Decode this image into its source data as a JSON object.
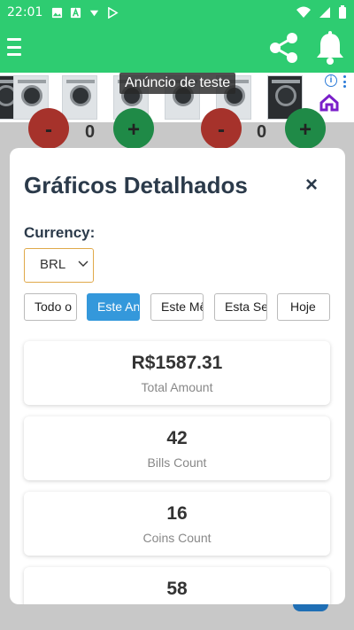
{
  "status_bar": {
    "time": "22:01",
    "icons": [
      "image-icon",
      "font-icon",
      "download-icon",
      "play-store-icon",
      "wifi-icon",
      "cell-signal-icon",
      "battery-icon"
    ]
  },
  "app_bar": {
    "color": "#2ecc71",
    "icons": [
      "menu-icon",
      "share-icon",
      "bell-icon"
    ]
  },
  "ad": {
    "label": "Anúncio de teste",
    "info": "i"
  },
  "background_controls": {
    "left": {
      "minus": "-",
      "count": "0",
      "plus": "+"
    },
    "right": {
      "minus": "-",
      "count": "0",
      "plus": "+"
    }
  },
  "modal": {
    "title": "Gráficos Detalhados",
    "close": "×",
    "currency_label": "Currency:",
    "currency_value": "BRL",
    "filters": [
      {
        "label": "Todo o Período",
        "active": false
      },
      {
        "label": "Este Ano",
        "active": true
      },
      {
        "label": "Este Mês",
        "active": false
      },
      {
        "label": "Esta Semana",
        "active": false
      },
      {
        "label": "Hoje",
        "active": false
      }
    ],
    "stats": [
      {
        "value": "R$1587.31",
        "label": "Total Amount"
      },
      {
        "value": "42",
        "label": "Bills Count"
      },
      {
        "value": "16",
        "label": "Coins Count"
      },
      {
        "value": "58",
        "label": ""
      }
    ]
  },
  "colors": {
    "accent_green": "#2ecc71",
    "active_blue": "#3498db",
    "title_text": "#2b3a4a",
    "select_border": "#e0a94a"
  }
}
